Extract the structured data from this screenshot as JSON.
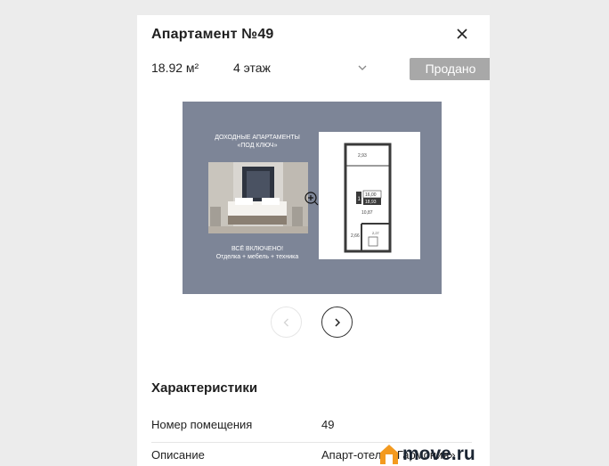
{
  "header": {
    "title": "Апартамент №49"
  },
  "summary": {
    "area": "18.92 м²",
    "floor": "4 этаж",
    "status": "Продано"
  },
  "plan_image": {
    "promo_line1": "ДОХОДНЫЕ АПАРТАМЕНТЫ",
    "promo_line2": "«ПОД КЛЮЧ»",
    "promo_line3": "ВСЁ ВКЛЮЧЕНО!",
    "promo_line4": "Отделка + мебель + техника",
    "dims": {
      "top": "2,93",
      "room_num": "1",
      "room_a": "16,00",
      "room_b": "18,93",
      "mid": "10,87",
      "left": "2,66",
      "bath": "2,27"
    }
  },
  "characteristics": {
    "heading": "Характеристики",
    "rows": [
      {
        "label": "Номер помещения",
        "value": "49"
      },
      {
        "label": "Описание",
        "value": "Апарт-отель «Гармония»"
      }
    ]
  },
  "watermark": {
    "text": "move.ru"
  },
  "colors": {
    "sold_bg": "#a8a8a8",
    "plan_bg": "#7d8597",
    "watermark_orange": "#f39a1f"
  },
  "icons": [
    "close-icon",
    "chevron-down-icon",
    "zoom-in-icon",
    "arrow-left-icon",
    "arrow-right-icon",
    "move-house-icon"
  ]
}
